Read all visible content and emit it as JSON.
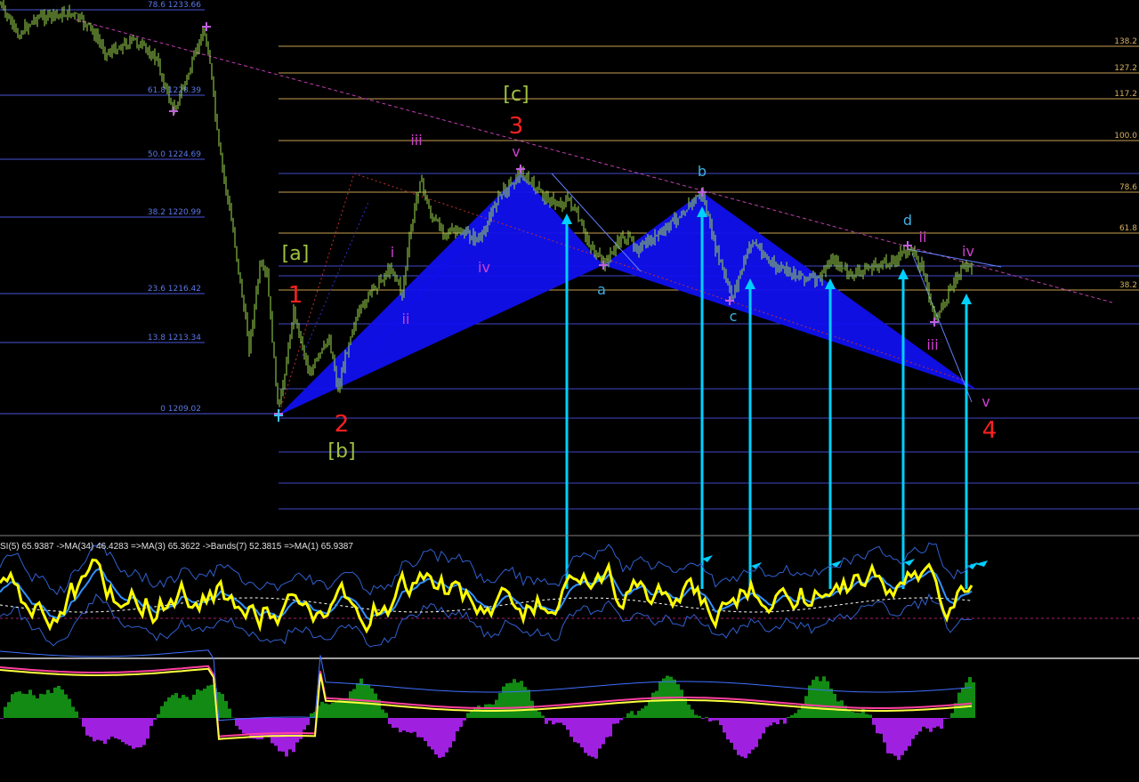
{
  "window": {
    "symbol_header": "",
    "indicator_header": "SI(5) 65.9387  ->MA(34) 46.4283  =>MA(3) 65.3622  ->Bands(7) 52.3815  =>MA(1) 65.9387"
  },
  "colors": {
    "background": "#000000",
    "price_up": "#9fdc4f",
    "fib_left": "#4a55d8",
    "fib_right": "#c8a050",
    "harmonic_fill": "#1010ee",
    "trendline": "#c03fb0",
    "arrow": "#00d0ff",
    "rsi": "#ffff00",
    "ma_blue": "#3090ff",
    "bands": "#3060d0",
    "hist_pos": "#138a13",
    "hist_neg": "#a020e0"
  },
  "fib_left_labels": [
    {
      "pct": "78.6",
      "price": "1233.66"
    },
    {
      "pct": "61.8",
      "price": "1228.39"
    },
    {
      "pct": "50.0",
      "price": "1224.69"
    },
    {
      "pct": "38.2",
      "price": "1220.99"
    },
    {
      "pct": "23.6",
      "price": "1216.42"
    },
    {
      "pct": "13.8",
      "price": "1213.34"
    },
    {
      "pct": "0",
      "price": "1209.02"
    }
  ],
  "fib_right_labels": [
    "138.2",
    "127.2",
    "117.2",
    "100.0",
    "78.6",
    "61.8",
    "38.2"
  ],
  "wave_labels": {
    "a_bracket": "[a]",
    "b_bracket": "[b]",
    "c_bracket": "[c]",
    "w1": "1",
    "w2": "2",
    "w3": "3",
    "w4": "4",
    "i1": "i",
    "ii1": "ii",
    "iii1": "iii",
    "iv1": "iv",
    "v1": "v",
    "a": "a",
    "b": "b",
    "c": "c",
    "d": "d",
    "ii2": "ii",
    "iii2": "iii",
    "iv2": "iv",
    "v2": "v"
  },
  "chart_data": {
    "type": "line",
    "title": "",
    "panels": [
      "price",
      "oscillator",
      "histogram"
    ],
    "fib_retracement": [
      {
        "level": 78.6,
        "price": 1233.66
      },
      {
        "level": 61.8,
        "price": 1228.39
      },
      {
        "level": 50.0,
        "price": 1224.69
      },
      {
        "level": 38.2,
        "price": 1220.99
      },
      {
        "level": 23.6,
        "price": 1216.42
      },
      {
        "level": 13.8,
        "price": 1213.34
      },
      {
        "level": 0,
        "price": 1209.02
      }
    ],
    "fib_extension_levels": [
      138.2,
      127.2,
      117.2,
      100.0,
      78.6,
      61.8,
      38.2
    ],
    "oscillator": {
      "name": "SI(5)",
      "value": 65.9387,
      "ma34": 46.4283,
      "ma3": 65.3622,
      "bands7": 52.3815,
      "ma1": 65.9387
    },
    "wave_count": [
      "[a]",
      "[b]",
      "[c]",
      "1",
      "2",
      "3",
      "4",
      "a",
      "b",
      "c",
      "d"
    ]
  }
}
